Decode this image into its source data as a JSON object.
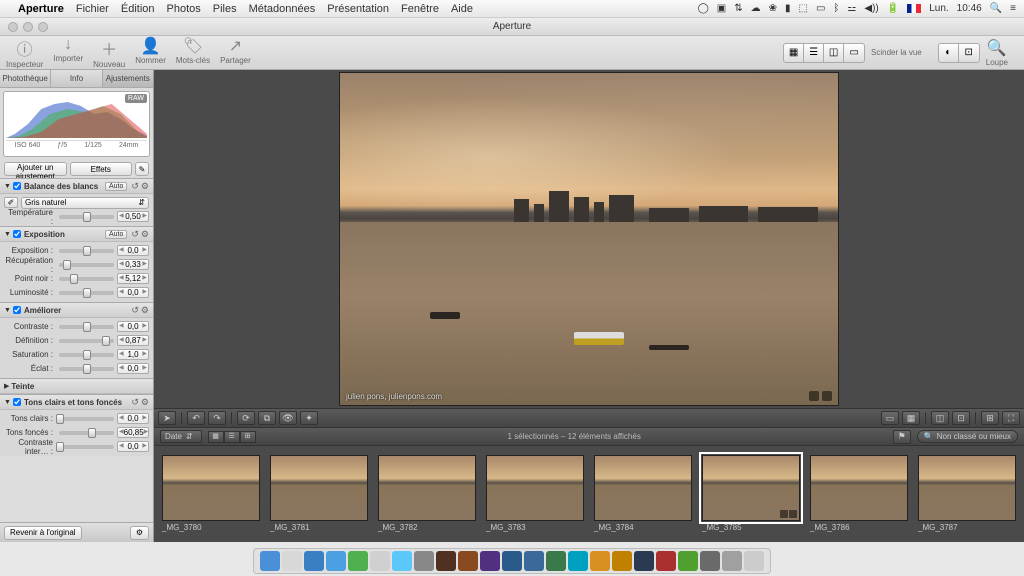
{
  "menubar": {
    "app": "Aperture",
    "items": [
      "Fichier",
      "Édition",
      "Photos",
      "Piles",
      "Métadonnées",
      "Présentation",
      "Fenêtre",
      "Aide"
    ],
    "clock_day": "Lun.",
    "clock_time": "10:46"
  },
  "window": {
    "title": "Aperture"
  },
  "toolbar": {
    "buttons": [
      {
        "icon": "ⓘ",
        "label": "Inspecteur"
      },
      {
        "icon": "↓",
        "label": "Importer"
      },
      {
        "icon": "＋",
        "label": "Nouveau"
      },
      {
        "icon": "👤",
        "label": "Nommer"
      },
      {
        "icon": "🏷",
        "label": "Mots-clés"
      },
      {
        "icon": "↗",
        "label": "Partager"
      }
    ],
    "right": {
      "split_label": "Scinder la vue",
      "loupe_label": "Loupe"
    }
  },
  "sidebar": {
    "tabs": [
      "Photothèque",
      "Info",
      "Ajustements"
    ],
    "active_tab": 2,
    "histogram": {
      "raw": "RAW",
      "meta": [
        "ISO 640",
        "ƒ/5",
        "1/125",
        "24mm"
      ]
    },
    "adjustment_dropdown": "Ajouter un ajustement",
    "effects_dropdown": "Effets",
    "panels": {
      "white_balance": {
        "title": "Balance des blancs",
        "auto": "Auto",
        "mode": "Gris naturel",
        "temperature": {
          "label": "Température :",
          "value": "0,50",
          "pos": 50
        }
      },
      "exposure": {
        "title": "Exposition",
        "auto": "Auto",
        "params": [
          {
            "label": "Exposition :",
            "value": "0,0",
            "pos": 50
          },
          {
            "label": "Récupération :",
            "value": "0,33",
            "pos": 15
          },
          {
            "label": "Point noir :",
            "value": "5,12",
            "pos": 28
          },
          {
            "label": "Luminosité :",
            "value": "0,0",
            "pos": 50
          }
        ]
      },
      "enhance": {
        "title": "Améliorer",
        "params": [
          {
            "label": "Contraste :",
            "value": "0,0",
            "pos": 50
          },
          {
            "label": "Définition :",
            "value": "0,87",
            "pos": 85
          },
          {
            "label": "Saturation :",
            "value": "1,0",
            "pos": 50
          },
          {
            "label": "Éclat :",
            "value": "0,0",
            "pos": 50
          }
        ]
      },
      "tint": {
        "title": "Teinte"
      },
      "highlights": {
        "title": "Tons clairs et tons foncés",
        "params": [
          {
            "label": "Tons clairs :",
            "value": "0,0",
            "pos": 2
          },
          {
            "label": "Tons foncés :",
            "value": "60,85",
            "pos": 60
          },
          {
            "label": "Contraste inter… :",
            "value": "0,0",
            "pos": 2
          }
        ]
      }
    },
    "footer": {
      "revert": "Revenir à l'original"
    }
  },
  "viewer": {
    "caption": "julien pons, julienpons.com"
  },
  "filter_bar": {
    "sort": "Date",
    "status": "1 sélectionnés – 12 éléments affichés",
    "search": "Non classé ou mieux"
  },
  "filmstrip": {
    "items": [
      {
        "name": "_MG_3780",
        "selected": false
      },
      {
        "name": "_MG_3781",
        "selected": false
      },
      {
        "name": "_MG_3782",
        "selected": false
      },
      {
        "name": "_MG_3783",
        "selected": false
      },
      {
        "name": "_MG_3784",
        "selected": false
      },
      {
        "name": "_MG_3785",
        "selected": true
      },
      {
        "name": "_MG_3786",
        "selected": false
      },
      {
        "name": "_MG_3787",
        "selected": false
      }
    ]
  },
  "dock": {
    "colors": [
      "#4a90d9",
      "#d8d8d8",
      "#3a7fc4",
      "#4aa0e0",
      "#50b050",
      "#d0d0d0",
      "#5ac8fa",
      "#888",
      "#503020",
      "#8a4a20",
      "#503080",
      "#2a5a8a",
      "#3a6a9a",
      "#3a7a4a",
      "#00a0c0",
      "#d89020",
      "#c08000",
      "#2a3a50",
      "#aa3030",
      "#50a030",
      "#6a6a6a",
      "#a0a0a0",
      "#ccc"
    ]
  }
}
